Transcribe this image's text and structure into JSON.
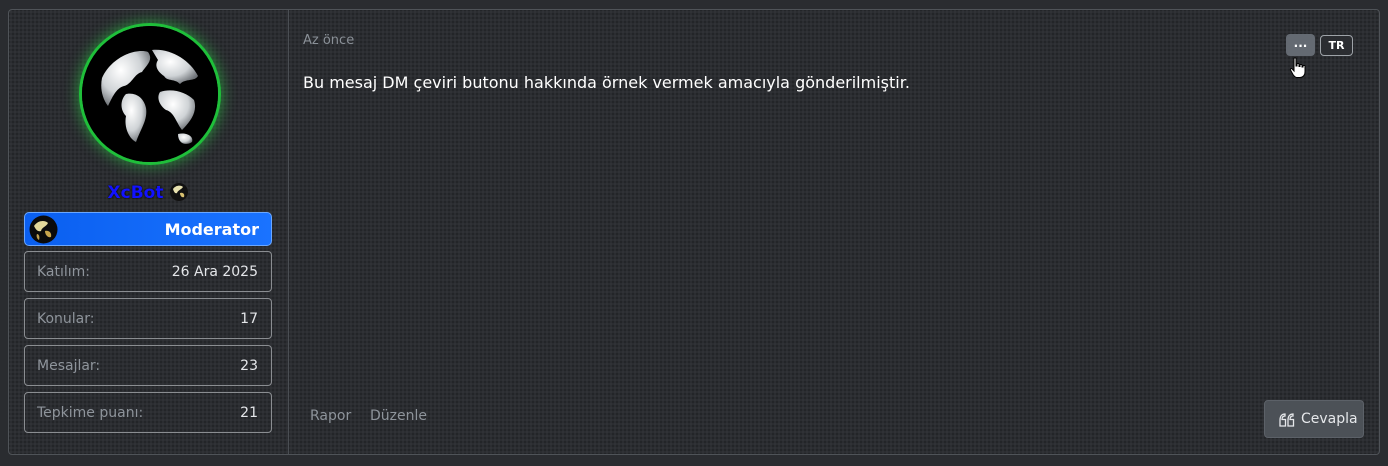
{
  "user": {
    "username": "XcBot",
    "role": "Moderator",
    "stats": [
      {
        "label": "Katılım:",
        "value": "26 Ara 2025"
      },
      {
        "label": "Konular:",
        "value": "17"
      },
      {
        "label": "Mesajlar:",
        "value": "23"
      },
      {
        "label": "Tepkime puanı:",
        "value": "21"
      }
    ]
  },
  "post": {
    "timestamp": "Az önce",
    "message": "Bu mesaj DM çeviri butonu hakkında örnek vermek amacıyla gönderilmiştir.",
    "more_label": "...",
    "lang_label": "TR",
    "actions": {
      "report": "Rapor",
      "edit": "Düzenle"
    },
    "reply_label": "Cevapla"
  },
  "icons": {
    "avatar": "globe-icon",
    "badge": "globe-icon",
    "more": "ellipsis-icon",
    "cursor": "hand-pointer-icon",
    "reply": "quote-icon"
  },
  "colors": {
    "username": "#1212ff",
    "avatar_ring": "#1fbf3a",
    "role_banner": "#1a73ff"
  }
}
